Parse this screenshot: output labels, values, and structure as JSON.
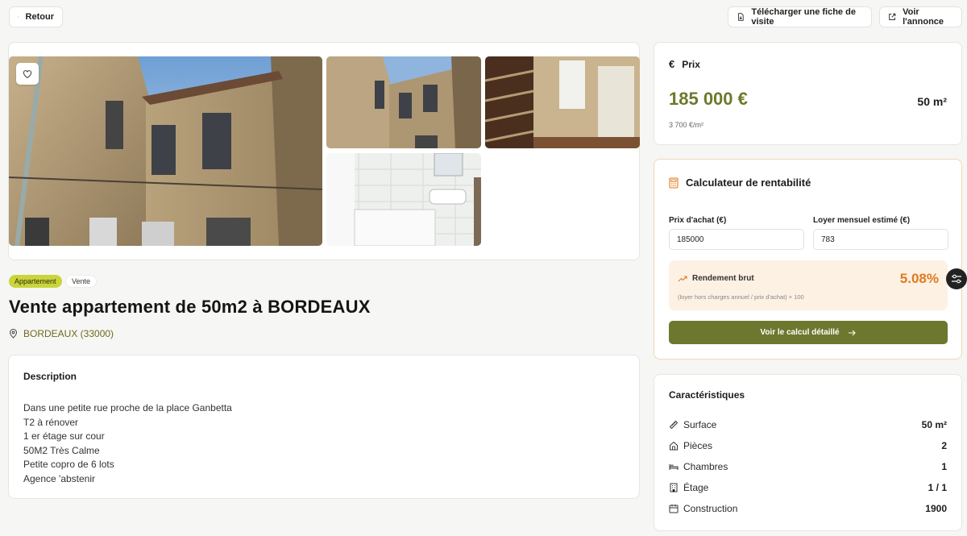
{
  "top": {
    "back_label": "Retour",
    "download_label": "Télécharger une fiche de visite",
    "view_label": "Voir l'annonce"
  },
  "listing": {
    "tags": [
      "Appartement",
      "Vente"
    ],
    "title": "Vente appartement de 50m2 à BORDEAUX",
    "location": "BORDEAUX (33000)"
  },
  "description": {
    "heading": "Description",
    "lines": [
      "Dans une petite rue proche de la place Ganbetta",
      "T2 à rénover",
      "1 er étage sur cour",
      "50M2 Très Calme",
      "Petite copro de 6 lots",
      "Agence 'abstenir"
    ]
  },
  "price": {
    "heading": "Prix",
    "amount": "185 000 €",
    "surface": "50 m²",
    "per_m2": "3 700 €/m²"
  },
  "calculator": {
    "heading": "Calculateur de rentabilité",
    "purchase_label": "Prix d'achat (€)",
    "purchase_value": "185000",
    "rent_label": "Loyer mensuel estimé (€)",
    "rent_value": "783",
    "yield_label": "Rendement brut",
    "yield_value": "5.08%",
    "yield_note": "(loyer hors charges annuel / prix d'achat) × 100",
    "cta_label": "Voir le calcul détaillé"
  },
  "features": {
    "heading": "Caractéristiques",
    "items": [
      {
        "label": "Surface",
        "value": "50 m²",
        "icon": "ruler-icon"
      },
      {
        "label": "Pièces",
        "value": "2",
        "icon": "home-icon"
      },
      {
        "label": "Chambres",
        "value": "1",
        "icon": "bed-icon"
      },
      {
        "label": "Étage",
        "value": "1 / 1",
        "icon": "building-icon"
      },
      {
        "label": "Construction",
        "value": "1900",
        "icon": "calendar-icon"
      }
    ]
  },
  "colors": {
    "accent_olive": "#6d782e",
    "price_green": "#6b7a2c",
    "yield_orange": "#e07a1d",
    "tag_lime": "#c9d53a"
  }
}
